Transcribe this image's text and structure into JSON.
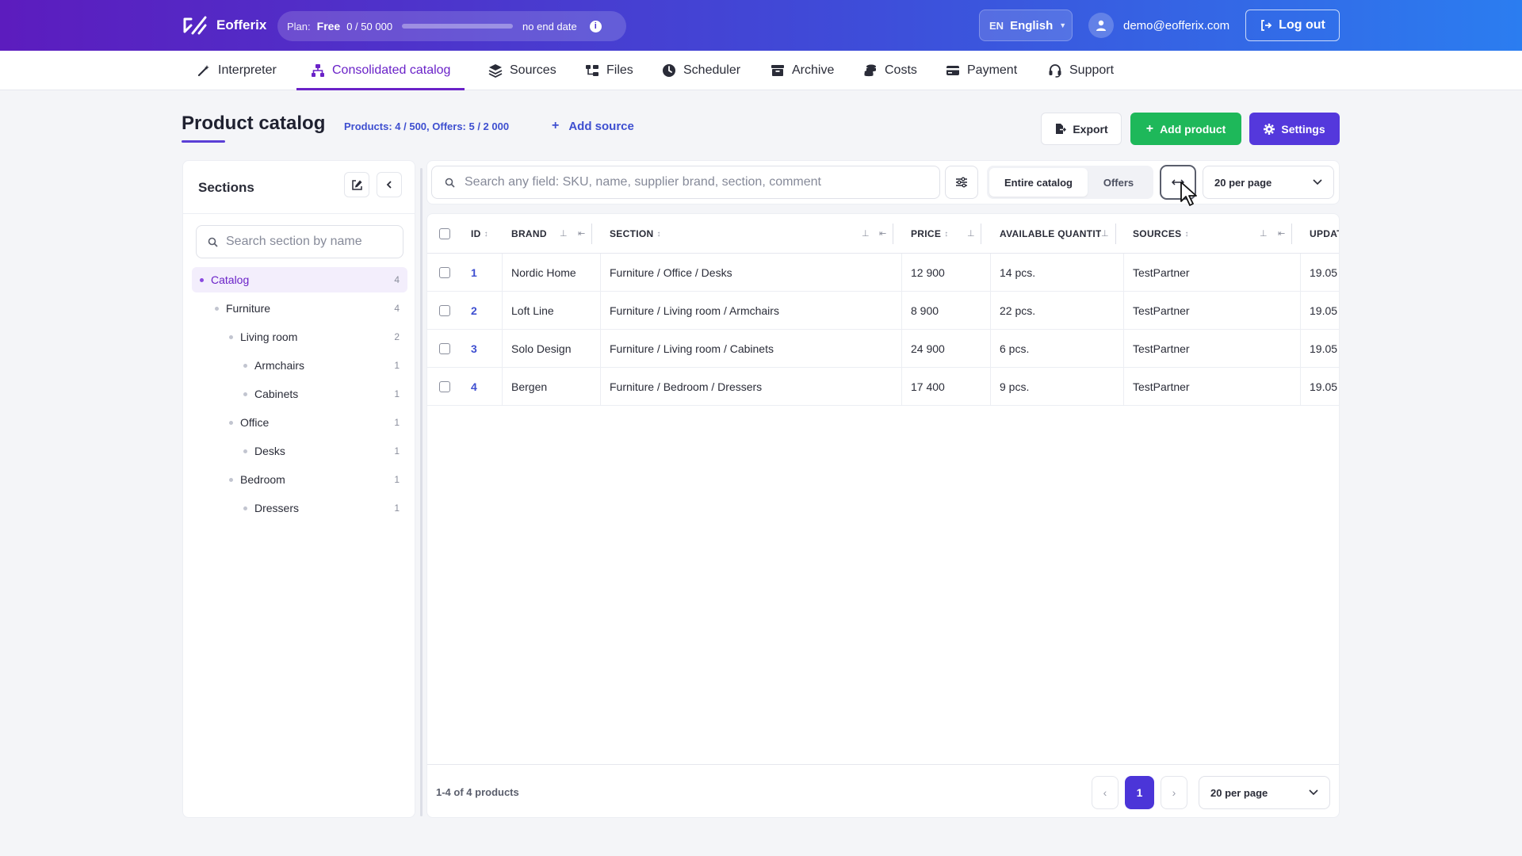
{
  "app": {
    "name": "Eofferix"
  },
  "plan": {
    "label": "Plan:",
    "name": "Free",
    "usage": "0 / 50 000",
    "progress": 0,
    "end": "no end date"
  },
  "lang": {
    "code": "EN",
    "name": "English"
  },
  "user": {
    "email": "demo@eofferix.com"
  },
  "logout_label": "Log out",
  "nav": [
    {
      "label": "Interpreter",
      "icon": "wand-icon"
    },
    {
      "label": "Consolidated catalog",
      "icon": "sitemap-icon",
      "active": true
    },
    {
      "label": "Sources",
      "icon": "layers-icon"
    },
    {
      "label": "Files",
      "icon": "folder-tree-icon"
    },
    {
      "label": "Scheduler",
      "icon": "clock-icon"
    },
    {
      "label": "Archive",
      "icon": "archive-icon"
    },
    {
      "label": "Costs",
      "icon": "coins-icon"
    },
    {
      "label": "Payment",
      "icon": "credit-card-icon"
    },
    {
      "label": "Support",
      "icon": "headset-icon"
    }
  ],
  "page": {
    "title": "Product catalog",
    "stats": "Products: 4 / 500, Offers: 5 / 2 000",
    "add_source": "Add source",
    "export": "Export",
    "add_product": "Add product",
    "settings": "Settings"
  },
  "sidebar": {
    "title": "Sections",
    "search_placeholder": "Search section by name",
    "tree": [
      {
        "label": "Catalog",
        "count": "4",
        "level": 0,
        "selected": true
      },
      {
        "label": "Furniture",
        "count": "4",
        "level": 1
      },
      {
        "label": "Living room",
        "count": "2",
        "level": 2
      },
      {
        "label": "Armchairs",
        "count": "1",
        "level": 3
      },
      {
        "label": "Cabinets",
        "count": "1",
        "level": 3
      },
      {
        "label": "Office",
        "count": "1",
        "level": 2
      },
      {
        "label": "Desks",
        "count": "1",
        "level": 3
      },
      {
        "label": "Bedroom",
        "count": "1",
        "level": 2
      },
      {
        "label": "Dressers",
        "count": "1",
        "level": 3
      }
    ]
  },
  "toolbar": {
    "search_placeholder": "Search any field: SKU, name, supplier brand, section, comment",
    "seg_all": "Entire catalog",
    "seg_offers": "Offers",
    "per_page": "20 per page"
  },
  "table": {
    "columns": [
      "ID",
      "BRAND",
      "SECTION",
      "PRICE",
      "AVAILABLE QUANTITY",
      "SOURCES",
      "UPDATED"
    ],
    "rows": [
      {
        "id": "1",
        "brand": "Nordic Home",
        "section": "Furniture / Office / Desks",
        "price": "12 900",
        "qty": "14 pcs.",
        "source": "TestPartner",
        "updated": "19.05"
      },
      {
        "id": "2",
        "brand": "Loft Line",
        "section": "Furniture / Living room / Armchairs",
        "price": "8 900",
        "qty": "22 pcs.",
        "source": "TestPartner",
        "updated": "19.05"
      },
      {
        "id": "3",
        "brand": "Solo Design",
        "section": "Furniture / Living room / Cabinets",
        "price": "24 900",
        "qty": "6 pcs.",
        "source": "TestPartner",
        "updated": "19.05"
      },
      {
        "id": "4",
        "brand": "Bergen",
        "section": "Furniture / Bedroom / Dressers",
        "price": "17 400",
        "qty": "9 pcs.",
        "source": "TestPartner",
        "updated": "19.05"
      }
    ]
  },
  "footer": {
    "count": "1-4 of 4 products",
    "page": "1",
    "per_page": "20 per page",
    "prev": "‹",
    "next": "›"
  },
  "colors": {
    "accent": "#6a22c8",
    "primary": "#5438dc",
    "success": "#1eb85a",
    "link": "#3e4fd0"
  }
}
